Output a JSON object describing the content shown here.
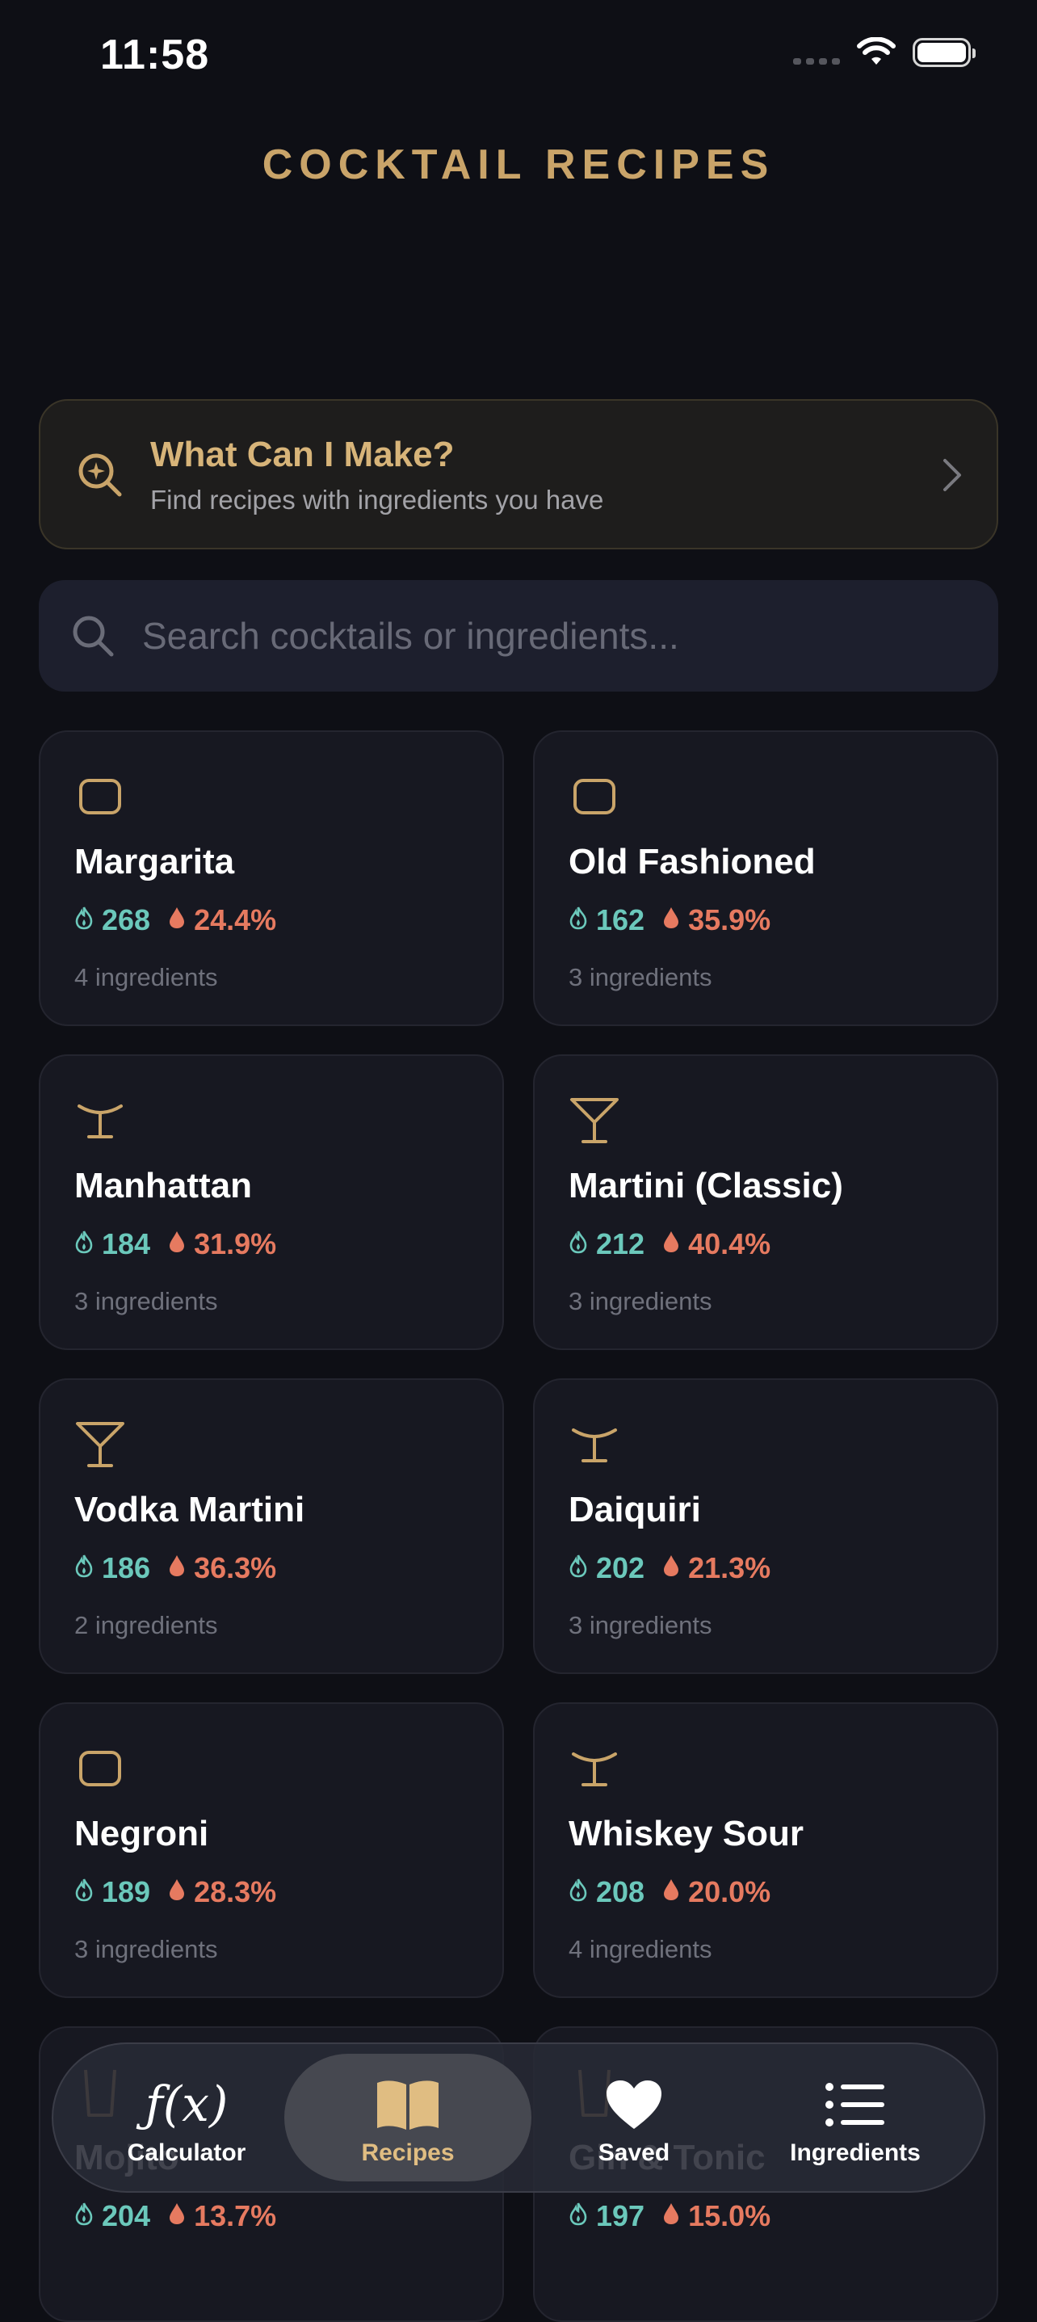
{
  "status": {
    "time": "11:58"
  },
  "header": {
    "title": "COCKTAIL RECIPES"
  },
  "finder": {
    "title": "What Can I Make?",
    "subtitle": "Find recipes with ingredients you have"
  },
  "search": {
    "placeholder": "Search cocktails or ingredients..."
  },
  "cocktails": [
    {
      "name": "Margarita",
      "calories": "268",
      "abv": "24.4%",
      "ingredients": "4 ingredients",
      "icon": "rocks-glass-icon"
    },
    {
      "name": "Old Fashioned",
      "calories": "162",
      "abv": "35.9%",
      "ingredients": "3 ingredients",
      "icon": "rocks-glass-icon"
    },
    {
      "name": "Manhattan",
      "calories": "184",
      "abv": "31.9%",
      "ingredients": "3 ingredients",
      "icon": "coupe-glass-icon"
    },
    {
      "name": "Martini (Classic)",
      "calories": "212",
      "abv": "40.4%",
      "ingredients": "3 ingredients",
      "icon": "martini-glass-icon"
    },
    {
      "name": "Vodka Martini",
      "calories": "186",
      "abv": "36.3%",
      "ingredients": "2 ingredients",
      "icon": "martini-glass-icon"
    },
    {
      "name": "Daiquiri",
      "calories": "202",
      "abv": "21.3%",
      "ingredients": "3 ingredients",
      "icon": "coupe-glass-icon"
    },
    {
      "name": "Negroni",
      "calories": "189",
      "abv": "28.3%",
      "ingredients": "3 ingredients",
      "icon": "rocks-glass-icon"
    },
    {
      "name": "Whiskey Sour",
      "calories": "208",
      "abv": "20.0%",
      "ingredients": "4 ingredients",
      "icon": "coupe-glass-icon"
    },
    {
      "name": "Mojito",
      "calories": "204",
      "abv": "13.7%",
      "ingredients": "",
      "icon": "highball-glass-icon"
    },
    {
      "name": "Gin & Tonic",
      "calories": "197",
      "abv": "15.0%",
      "ingredients": "",
      "icon": "highball-glass-icon"
    }
  ],
  "tabs": [
    {
      "label": "Calculator",
      "icon": "function-icon",
      "glyph": "ƒ(x)"
    },
    {
      "label": "Recipes",
      "icon": "book-icon",
      "active": true
    },
    {
      "label": "Saved",
      "icon": "heart-icon"
    },
    {
      "label": "Ingredients",
      "icon": "list-icon"
    }
  ],
  "colors": {
    "background": "#0e0f15",
    "accent_gold": "#c9a469",
    "calories_teal": "#6bc8bb",
    "abv_coral": "#e67a60",
    "card": "#171821"
  }
}
